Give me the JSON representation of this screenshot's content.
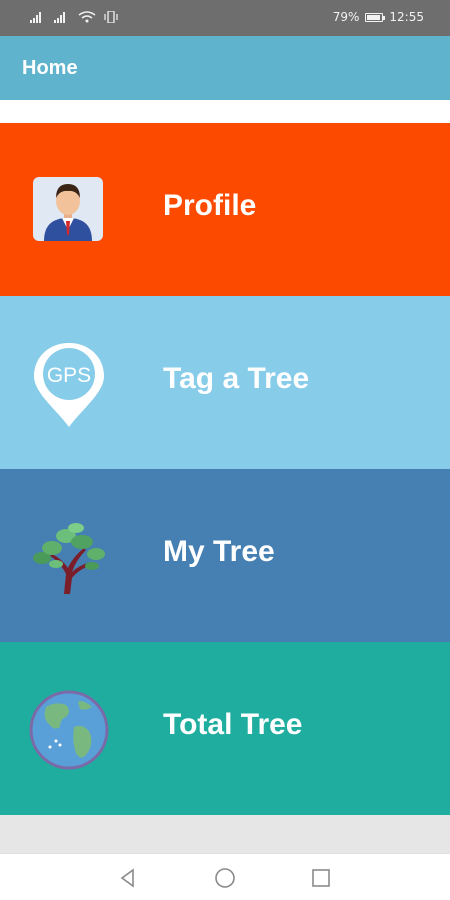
{
  "status_bar": {
    "battery_percent_text": "79%",
    "battery_level": 0.79,
    "time": "12:55",
    "icons": [
      "signal-1-icon",
      "signal-2-icon",
      "wifi-icon",
      "vibrate-icon",
      "battery-icon"
    ]
  },
  "app_bar": {
    "title": "Home"
  },
  "menu": [
    {
      "label": "Profile",
      "icon": "profile-avatar-icon",
      "color": "#fd4a01"
    },
    {
      "label": "Tag a Tree",
      "icon": "gps-pin-icon",
      "icon_text": "GPS",
      "color": "#87cce9"
    },
    {
      "label": "My Tree",
      "icon": "tree-icon",
      "color": "#4680b3"
    },
    {
      "label": "Total Tree",
      "icon": "globe-icon",
      "color": "#1ead9e"
    }
  ],
  "nav_bar": {
    "buttons": [
      "back-icon",
      "home-icon",
      "recents-icon"
    ]
  }
}
